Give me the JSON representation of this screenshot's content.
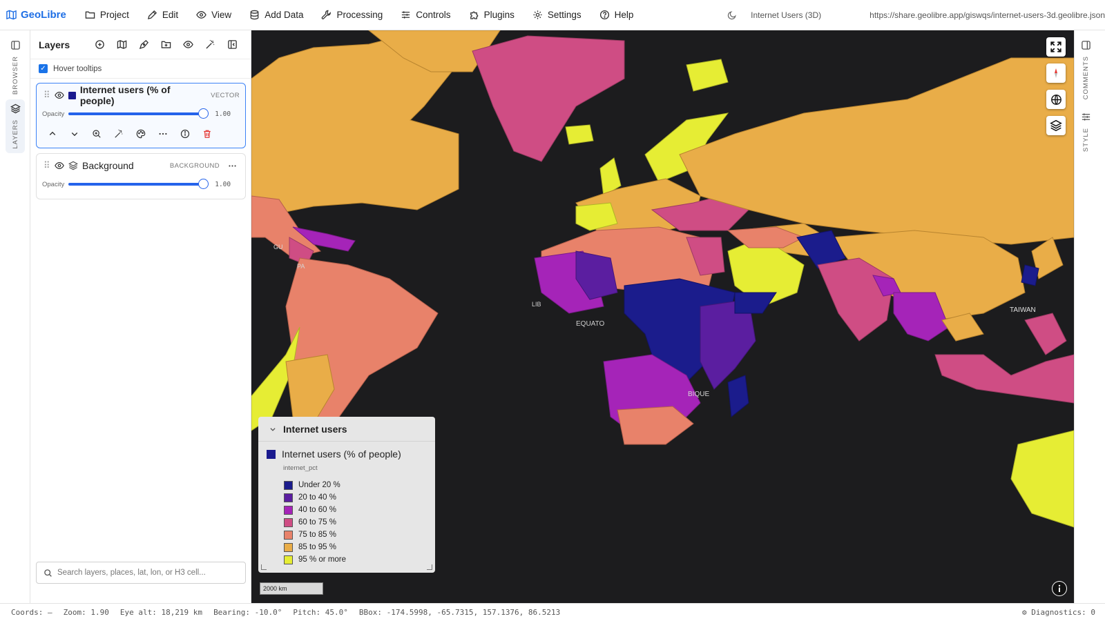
{
  "app": {
    "brand": "GeoLibre"
  },
  "menu": {
    "items": [
      {
        "label": "Project",
        "icon": "folder-icon"
      },
      {
        "label": "Edit",
        "icon": "pencil-icon"
      },
      {
        "label": "View",
        "icon": "eye-icon"
      },
      {
        "label": "Add Data",
        "icon": "database-icon"
      },
      {
        "label": "Processing",
        "icon": "wrench-icon"
      },
      {
        "label": "Controls",
        "icon": "sliders-icon"
      },
      {
        "label": "Plugins",
        "icon": "puzzle-icon"
      },
      {
        "label": "Settings",
        "icon": "gear-icon"
      },
      {
        "label": "Help",
        "icon": "help-icon"
      }
    ],
    "project_name": "Internet Users (3D)",
    "share_url": "https://share.geolibre.app/giswqs/internet-users-3d.geolibre.json"
  },
  "left_rail": {
    "browser_label": "BROWSER",
    "layers_label": "LAYERS"
  },
  "layers_panel": {
    "title": "Layers",
    "hover_tooltips_label": "Hover tooltips",
    "hover_tooltips_checked": true,
    "layers": [
      {
        "name": "Internet users (% of people)",
        "type": "VECTOR",
        "opacity_label": "Opacity",
        "opacity_value": "1.00",
        "swatch": "#1a1a8e",
        "active": true
      },
      {
        "name": "Background",
        "type": "BACKGROUND",
        "opacity_label": "Opacity",
        "opacity_value": "1.00",
        "active": false
      }
    ],
    "search_placeholder": "Search layers, places, lat, lon, or H3 cell..."
  },
  "legend": {
    "title": "Internet users",
    "layer_name": "Internet users (% of people)",
    "field": "internet_pct",
    "classes": [
      {
        "label": "Under 20 %",
        "color": "#1b1c8c"
      },
      {
        "label": "20 to 40 %",
        "color": "#5b1ea0"
      },
      {
        "label": "40 to 60 %",
        "color": "#a524b8"
      },
      {
        "label": "60 to 75 %",
        "color": "#cf4d84"
      },
      {
        "label": "75 to 85 %",
        "color": "#e8826a"
      },
      {
        "label": "85 to 95 %",
        "color": "#e9ad48"
      },
      {
        "label": "95 % or more",
        "color": "#e6ed34"
      }
    ]
  },
  "map": {
    "scale_label": "2000 km",
    "labels": [
      {
        "text": "EQUATO",
        "id": "label-equator"
      },
      {
        "text": "LIB",
        "id": "label-libya"
      },
      {
        "text": "BIQUE",
        "id": "label-mozambique"
      },
      {
        "text": "TAIWAN",
        "id": "label-taiwan"
      },
      {
        "text": "GU",
        "id": "label-gu"
      },
      {
        "text": "PA",
        "id": "label-pa"
      }
    ]
  },
  "right_rail": {
    "comments_label": "COMMENTS",
    "style_label": "STYLE"
  },
  "status": {
    "coords": "Coords: —",
    "zoom": "Zoom: 1.90",
    "eye_alt": "Eye alt: 18,219 km",
    "bearing": "Bearing: -10.0°",
    "pitch": "Pitch: 45.0°",
    "bbox": "BBox: -174.5998, -65.7315, 157.1376, 86.5213",
    "diagnostics": "Diagnostics: 0"
  }
}
